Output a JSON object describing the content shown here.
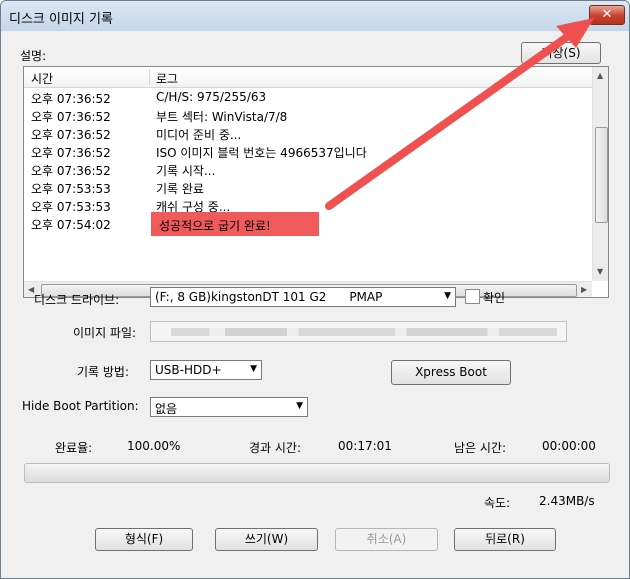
{
  "window": {
    "title": "디스크 이미지 기록",
    "close_label": "✕"
  },
  "description_label": "설명:",
  "save_button": "저장(S)",
  "log": {
    "columns": [
      "시간",
      "로그"
    ],
    "rows": [
      {
        "time": "오후 07:36:52",
        "message": "C/H/S: 975/255/63"
      },
      {
        "time": "오후 07:36:52",
        "message": "부트 섹터: WinVista/7/8"
      },
      {
        "time": "오후 07:36:52",
        "message": "미디어 준비 중..."
      },
      {
        "time": "오후 07:36:52",
        "message": "ISO 이미지 블럭 번호는 4966537입니다"
      },
      {
        "time": "오후 07:36:52",
        "message": "기록 시작..."
      },
      {
        "time": "오후 07:53:53",
        "message": "기록 완료"
      },
      {
        "time": "오후 07:53:53",
        "message": "캐쉬 구성 중..."
      },
      {
        "time": "오후 07:54:02",
        "message": "성공적으로 굽기 완료!"
      }
    ],
    "highlight_color": "#f05a5a"
  },
  "form": {
    "drive_label": "디스크 드라이브:",
    "drive_value": "(F:, 8 GB)kingstonDT 101 G2      PMAP",
    "verify_label": "확인",
    "image_file_label": "이미지 파일:",
    "write_method_label": "기록 방법:",
    "write_method_value": "USB-HDD+",
    "xpress_boot": "Xpress Boot",
    "hide_boot_label": "Hide Boot Partition:",
    "hide_boot_value": "없음"
  },
  "status": {
    "done_label": "완료율:",
    "done_value": "100.00%",
    "elapsed_label": "경과 시간:",
    "elapsed_value": "00:17:01",
    "remaining_label": "남은 시간:",
    "remaining_value": "00:00:00",
    "speed_label": "속도:",
    "speed_value": "2.43MB/s",
    "progress_fraction": 0
  },
  "buttons": {
    "format": "형식(F)",
    "write": "쓰기(W)",
    "cancel": "취소(A)",
    "back": "뒤로(R)"
  },
  "colors": {
    "arrow": "#f05050",
    "close": "#c7412f"
  }
}
